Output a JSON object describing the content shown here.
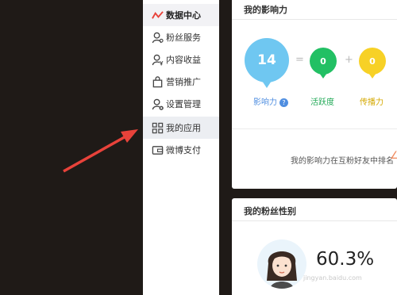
{
  "sidebar": {
    "items": [
      {
        "label": "数据中心",
        "icon": "trend-icon"
      },
      {
        "label": "粉丝服务",
        "icon": "user-icon"
      },
      {
        "label": "内容收益",
        "icon": "user-yuan-icon"
      },
      {
        "label": "营销推广",
        "icon": "bag-icon"
      },
      {
        "label": "设置管理",
        "icon": "user-gear-icon"
      },
      {
        "label": "我的应用",
        "icon": "grid-icon"
      },
      {
        "label": "微博支付",
        "icon": "wallet-icon"
      }
    ]
  },
  "influence": {
    "title": "我的影响力",
    "score": "14",
    "score_label": "影响力",
    "plus_sign": "=",
    "add_sign": "+",
    "activity": "0",
    "activity_label": "活跃度",
    "spread": "0",
    "spread_label": "传播力",
    "rank_text": "我的影响力在互粉好友中排名"
  },
  "gender": {
    "title": "我的粉丝性别",
    "female_percent": "60.3%",
    "watermark": "jingyan.baidu.com"
  },
  "colors": {
    "accent_red": "#e8423a",
    "influence_blue": "#6fc7f1",
    "activity_green": "#22c064",
    "spread_yellow": "#f7d126"
  }
}
